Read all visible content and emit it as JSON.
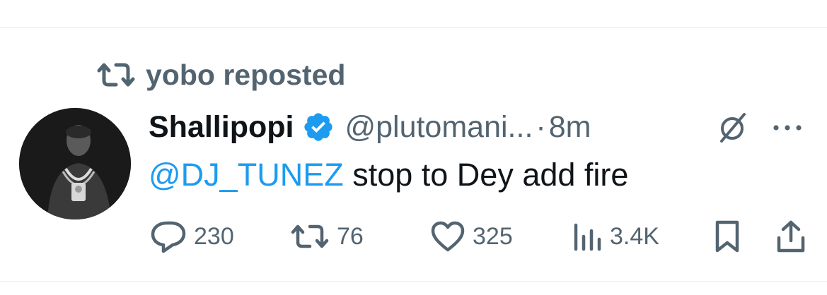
{
  "repost": {
    "label": "yobo reposted",
    "icon": "repost-icon"
  },
  "tweet": {
    "author_name": "Shallipopi",
    "verified": true,
    "verified_color": "#1d9bf0",
    "handle": "@plutomani...",
    "separator": "·",
    "time": "8m",
    "mention": "@DJ_TUNEZ",
    "text": " stop to Dey add fire"
  },
  "actions": {
    "replies": "230",
    "reposts": "76",
    "likes": "325",
    "views": "3.4K"
  },
  "icons": {
    "reply": "reply-icon",
    "repost": "repost-icon",
    "like": "heart-icon",
    "views": "views-chart-icon",
    "bookmark": "bookmark-icon",
    "share": "share-icon",
    "grok": "grok-icon",
    "more": "more-icon"
  },
  "colors": {
    "text_primary": "#0f1419",
    "text_secondary": "#536471",
    "link": "#1d9bf0",
    "divider": "#eff3f4"
  }
}
